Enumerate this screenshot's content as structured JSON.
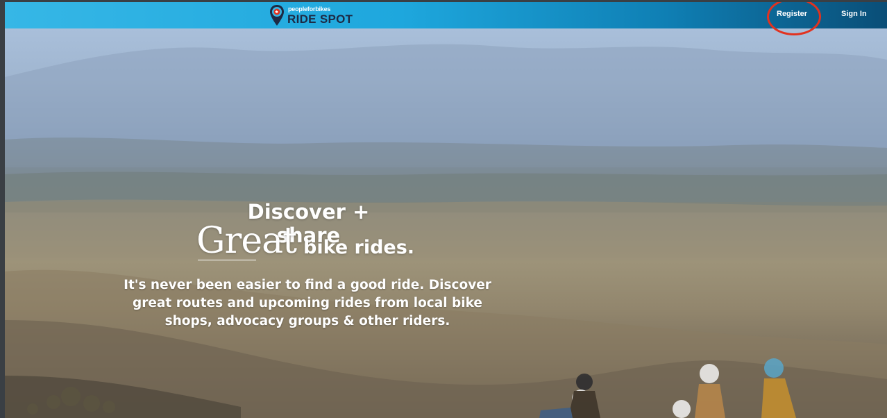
{
  "brand": {
    "small_text": "peopleforbikes",
    "name": "RIDE SPOT",
    "colors": {
      "bar_start": "#36b7e6",
      "bar_end": "#0a4e77",
      "logo_dark": "#1d2a44",
      "pin_red": "#e2321f"
    }
  },
  "nav": {
    "register_label": "Register",
    "signin_label": "Sign In"
  },
  "hero": {
    "headline_line1": "Discover + share",
    "headline_great": "Great",
    "headline_line2": "bike rides.",
    "subtext": "It's never been easier to find a good ride. Discover great routes and upcoming rides from local bike shops, advocacy groups & other riders."
  },
  "annotation": {
    "color": "#e2321f",
    "target": "Register"
  }
}
